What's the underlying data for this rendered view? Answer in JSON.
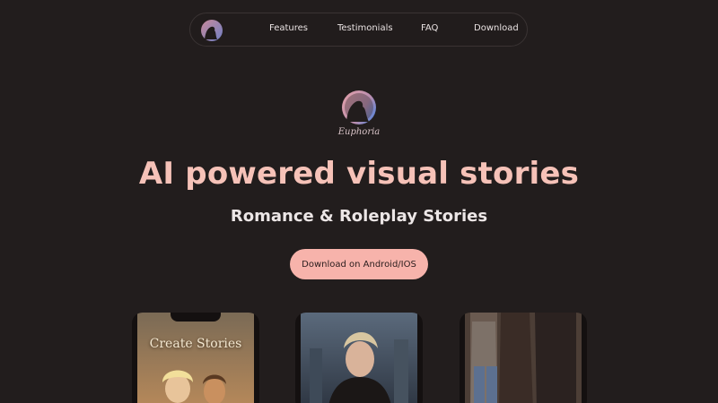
{
  "nav": {
    "logo_icon": "euphoria-silhouette-logo",
    "links": [
      "Features",
      "Testimonials",
      "FAQ",
      "Download"
    ]
  },
  "hero": {
    "logo_icon": "euphoria-silhouette-logo",
    "logo_text": "Euphoria",
    "title": "AI powered visual stories",
    "subtitle": "Romance & Roleplay Stories",
    "cta_label": "Download on Android/IOS"
  },
  "phones": [
    {
      "caption": "Create Stories",
      "image": "couple-illustration"
    },
    {
      "image": "man-leather-jacket-illustration"
    },
    {
      "image": "couple-walking-illustration"
    }
  ],
  "colors": {
    "background": "#221d1d",
    "accent": "#f7b3ab",
    "title": "#f6c2b8"
  }
}
